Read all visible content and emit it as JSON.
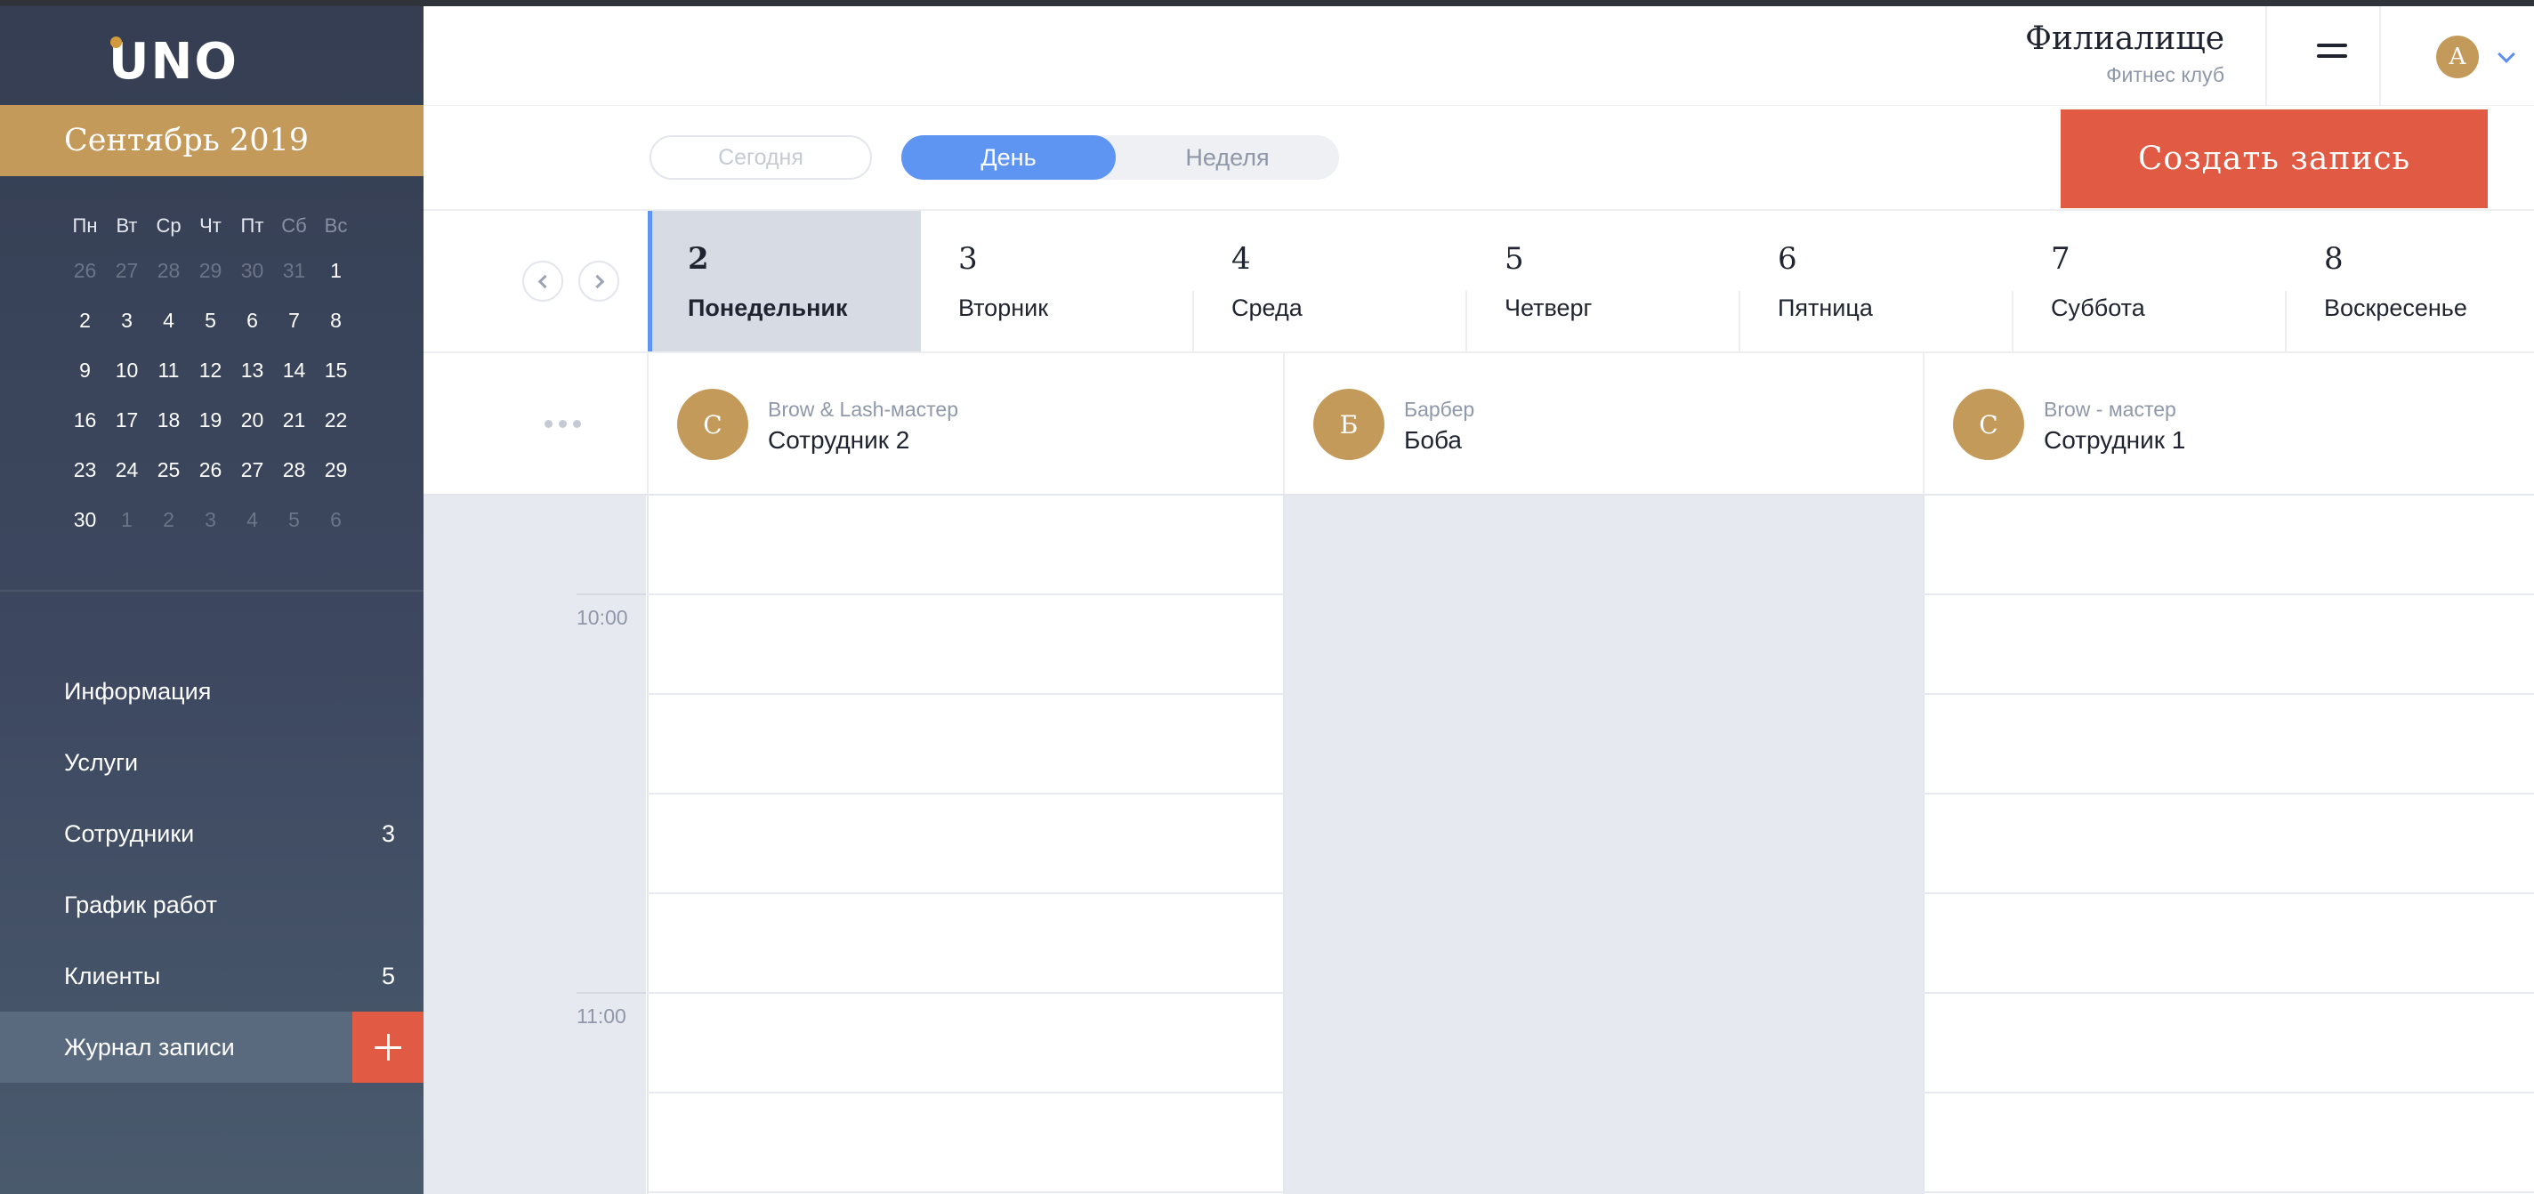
{
  "app": {
    "logo": "UNO"
  },
  "sidebar": {
    "month_title": "Сентябрь 2019",
    "weekdays": [
      "Пн",
      "Вт",
      "Ср",
      "Чт",
      "Пт",
      "Сб",
      "Вс"
    ],
    "weeks": [
      [
        {
          "d": "26",
          "m": true
        },
        {
          "d": "27",
          "m": true
        },
        {
          "d": "28",
          "m": true
        },
        {
          "d": "29",
          "m": true
        },
        {
          "d": "30",
          "m": true
        },
        {
          "d": "31",
          "m": true
        },
        {
          "d": "1",
          "m": false
        }
      ],
      [
        {
          "d": "2",
          "m": false
        },
        {
          "d": "3",
          "m": false
        },
        {
          "d": "4",
          "m": false
        },
        {
          "d": "5",
          "m": false
        },
        {
          "d": "6",
          "m": false
        },
        {
          "d": "7",
          "m": false
        },
        {
          "d": "8",
          "m": false
        }
      ],
      [
        {
          "d": "9",
          "m": false
        },
        {
          "d": "10",
          "m": false
        },
        {
          "d": "11",
          "m": false
        },
        {
          "d": "12",
          "m": false
        },
        {
          "d": "13",
          "m": false
        },
        {
          "d": "14",
          "m": false
        },
        {
          "d": "15",
          "m": false
        }
      ],
      [
        {
          "d": "16",
          "m": false
        },
        {
          "d": "17",
          "m": false
        },
        {
          "d": "18",
          "m": false
        },
        {
          "d": "19",
          "m": false
        },
        {
          "d": "20",
          "m": false
        },
        {
          "d": "21",
          "m": false
        },
        {
          "d": "22",
          "m": false
        }
      ],
      [
        {
          "d": "23",
          "m": false
        },
        {
          "d": "24",
          "m": false
        },
        {
          "d": "25",
          "m": false
        },
        {
          "d": "26",
          "m": false
        },
        {
          "d": "27",
          "m": false
        },
        {
          "d": "28",
          "m": false
        },
        {
          "d": "29",
          "m": false
        }
      ],
      [
        {
          "d": "30",
          "m": false
        },
        {
          "d": "1",
          "m": true
        },
        {
          "d": "2",
          "m": true
        },
        {
          "d": "3",
          "m": true
        },
        {
          "d": "4",
          "m": true
        },
        {
          "d": "5",
          "m": true
        },
        {
          "d": "6",
          "m": true
        }
      ]
    ],
    "menu": [
      {
        "id": "info",
        "label": "Информация",
        "count": ""
      },
      {
        "id": "services",
        "label": "Услуги",
        "count": ""
      },
      {
        "id": "staff",
        "label": "Сотрудники",
        "count": "3"
      },
      {
        "id": "schedule",
        "label": "График работ",
        "count": ""
      },
      {
        "id": "clients",
        "label": "Клиенты",
        "count": "5"
      },
      {
        "id": "journal",
        "label": "Журнал записи",
        "count": "",
        "active": true
      }
    ]
  },
  "header": {
    "branch_name": "Филиалище",
    "branch_type": "Фитнес клуб",
    "user_initial": "А"
  },
  "toolbar": {
    "today_label": "Сегодня",
    "day_label": "День",
    "week_label": "Неделя",
    "create_label": "Создать запись"
  },
  "days": [
    {
      "num": "2",
      "name": "Понедельник",
      "selected": true
    },
    {
      "num": "3",
      "name": "Вторник",
      "selected": false
    },
    {
      "num": "4",
      "name": "Среда",
      "selected": false
    },
    {
      "num": "5",
      "name": "Четверг",
      "selected": false
    },
    {
      "num": "6",
      "name": "Пятница",
      "selected": false
    },
    {
      "num": "7",
      "name": "Суббота",
      "selected": false
    },
    {
      "num": "8",
      "name": "Воскресенье",
      "selected": false
    }
  ],
  "staff": [
    {
      "initial": "С",
      "role": "Brow & Lash-мастер",
      "name": "Сотрудник 2",
      "busy": false
    },
    {
      "initial": "Б",
      "role": "Барбер",
      "name": "Боба",
      "busy": true
    },
    {
      "initial": "С",
      "role": "Brow - мастер",
      "name": "Сотрудник 1",
      "busy": false
    }
  ],
  "times": [
    "10:00",
    "11:00"
  ],
  "colors": {
    "accent": "#5f95f2",
    "create": "#e05a44",
    "gold": "#c49a5a",
    "sidebar": "#3a445a"
  },
  "icons": [
    "plus-icon",
    "menu-icon",
    "chevron-down-icon",
    "chevron-left-icon",
    "chevron-right-icon",
    "more-dots-icon"
  ]
}
